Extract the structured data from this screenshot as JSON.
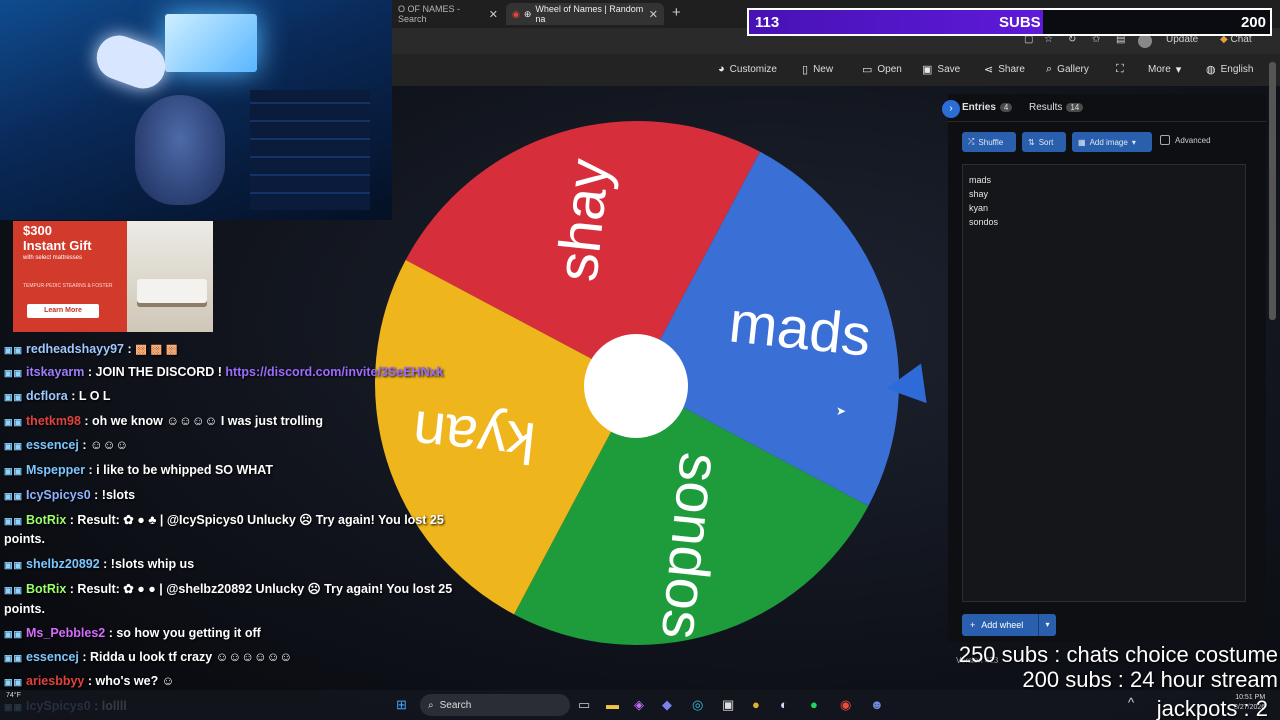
{
  "browser": {
    "tabs": [
      {
        "label": "O OF NAMES - Search",
        "active": false
      },
      {
        "label": "Wheel of Names | Random na",
        "active": true
      }
    ],
    "update_label": "Update",
    "chat_label": "Chat"
  },
  "subs_bar": {
    "current": "113",
    "label": "SUBS",
    "goal": "200",
    "progress": 0.565,
    "fill_color": "#5a18cf"
  },
  "toolbar": {
    "items": [
      {
        "label": "Customize",
        "icon": "palette-icon"
      },
      {
        "label": "New",
        "icon": "file-icon"
      },
      {
        "label": "Open",
        "icon": "folder-icon"
      },
      {
        "label": "Save",
        "icon": "save-icon"
      },
      {
        "label": "Share",
        "icon": "share-icon"
      },
      {
        "label": "Gallery",
        "icon": "search-icon"
      },
      {
        "label": "",
        "icon": "fullscreen-icon"
      },
      {
        "label": "More",
        "icon": "chevron-down-icon"
      },
      {
        "label": "English",
        "icon": "globe-icon"
      }
    ]
  },
  "wheel": {
    "slices": [
      {
        "label": "shay",
        "color": "#d62e3a"
      },
      {
        "label": "mads",
        "color": "#3a70d6"
      },
      {
        "label": "sondos",
        "color": "#1e9c3c"
      },
      {
        "label": "kyan",
        "color": "#efb51c"
      }
    ],
    "pointer_color": "#2f6bd8",
    "hub_color": "#ffffff"
  },
  "panel": {
    "entries_tab": "Entries",
    "entries_count": "4",
    "results_tab": "Results",
    "results_count": "14",
    "buttons": {
      "shuffle": "Shuffle",
      "sort": "Sort",
      "add_image": "Add image",
      "advanced": "Advanced"
    },
    "entries": [
      "mads",
      "shay",
      "kyan",
      "sondos"
    ],
    "add_wheel": "Add wheel",
    "version": "Version 423"
  },
  "ad": {
    "price": "$300",
    "headline": "Instant Gift",
    "subline": "with select mattresses",
    "brand": "TEMPUR-PEDIC   STEARNS & FOSTER",
    "cta": "Learn More"
  },
  "chat": [
    {
      "user": "redheadshayy97",
      "user_color": "#9fc8ff",
      "text": ": ",
      "emotes": "▩ ▩ ▩"
    },
    {
      "user": "itskayarm",
      "user_color": "#9f7dff",
      "text": ": JOIN THE DISCORD ! ",
      "link": "https://discord.com/invite/3SeEHNxk"
    },
    {
      "user": "dcflora",
      "user_color": "#9fc8ff",
      "text": ": L O L"
    },
    {
      "user": "thetkm98",
      "user_color": "#e0433b",
      "text": ": oh we know ☺☺☺☺ I was just trolling"
    },
    {
      "user": "essencej",
      "user_color": "#7cc7ff",
      "text": ": ☺☺☺"
    },
    {
      "user": "Mspepper",
      "user_color": "#7cc7ff",
      "text": ": i like to be whipped SO WHAT"
    },
    {
      "user": "IcySpicys0",
      "user_color": "#8fb3ff",
      "text": ": !slots"
    },
    {
      "user": "BotRix",
      "user_color": "#9bff6b",
      "text": ": Result: ✿ ● ♣ | @IcySpicys0 Unlucky ☹ Try again! You lost 25"
    },
    {
      "user": "",
      "user_color": "#fff",
      "text": "points."
    },
    {
      "user": "shelbz20892",
      "user_color": "#7cc7ff",
      "text": ": !slots whip us"
    },
    {
      "user": "BotRix",
      "user_color": "#9bff6b",
      "text": ": Result: ✿ ● ● | @shelbz20892 Unlucky ☹ Try again! You lost 25"
    },
    {
      "user": "",
      "user_color": "#fff",
      "text": "points."
    },
    {
      "user": "Ms_Pebbles2",
      "user_color": "#d66bff",
      "text": ": so how you getting it off"
    },
    {
      "user": "essencej",
      "user_color": "#7cc7ff",
      "text": ": Ridda u look tf crazy ☺☺☺☺☺☺"
    },
    {
      "user": "ariesbbyy",
      "user_color": "#e0433b",
      "text": ": who's we? ☺"
    },
    {
      "user": "IcySpicys0",
      "user_color": "#8fb3ff",
      "text": ": lollll"
    }
  ],
  "overlay": {
    "goal1": "250 subs : chats choice costume",
    "goal2": "200 subs : 24 hour stream",
    "ticker": "jackpots : 2"
  },
  "taskbar": {
    "search_placeholder": "Search",
    "temp": "74°F",
    "time": "10:51 PM",
    "date": "3/27/2026"
  }
}
